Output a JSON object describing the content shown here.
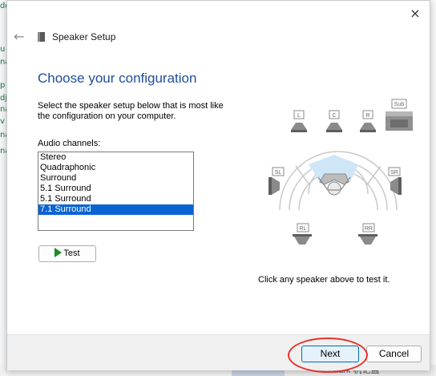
{
  "background": {
    "left_fragments": [
      "do",
      "u",
      "na",
      "p",
      "dj",
      "na",
      "v",
      "na",
      "na"
    ],
    "bottom_text": "uark 机记盐"
  },
  "dialog": {
    "title": "Speaker Setup",
    "close_icon": "×",
    "back_icon": "←",
    "heading": "Choose your configuration",
    "description": "Select the speaker setup below that is most like the configuration on your computer.",
    "audio_channels_label": "Audio channels:",
    "channels": [
      "Stereo",
      "Quadraphonic",
      "Surround",
      "5.1 Surround",
      "5.1 Surround",
      "7.1 Surround"
    ],
    "selected_channel": "7.1 Surround",
    "test_label": "Test",
    "speaker_labels": {
      "L": "L",
      "C": "C",
      "R": "R",
      "Sub": "Sub",
      "SL": "SL",
      "SR": "SR",
      "RL": "RL",
      "RR": "RR"
    },
    "hint": "Click any speaker above to test it.",
    "next_label": "Next",
    "cancel_label": "Cancel"
  },
  "colors": {
    "heading": "#1f4e9b",
    "selection": "#0a64d2",
    "next_border": "#0067c0",
    "highlight_ring": "#e5322d"
  }
}
